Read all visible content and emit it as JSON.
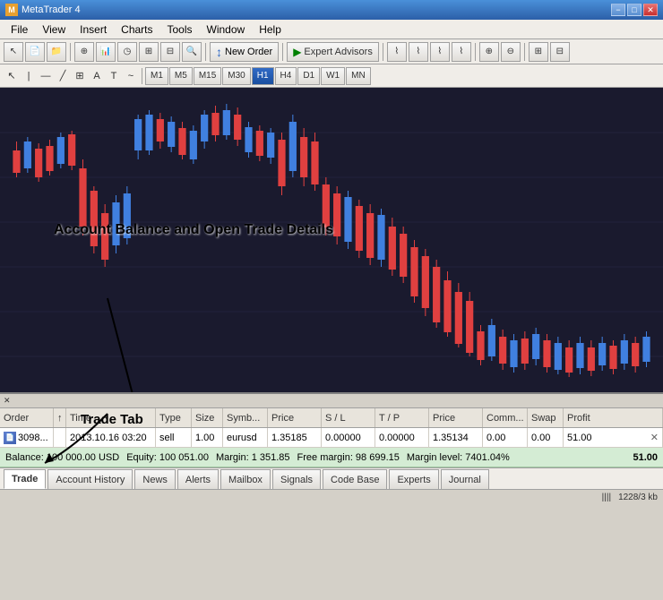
{
  "titleBar": {
    "title": "MetaTrader 4",
    "minimizeLabel": "−",
    "maximizeLabel": "□",
    "closeLabel": "✕"
  },
  "menuBar": {
    "items": [
      "File",
      "View",
      "Insert",
      "Charts",
      "Tools",
      "Window",
      "Help"
    ]
  },
  "toolbar": {
    "newOrderLabel": "New Order",
    "expertAdvisorsLabel": "Expert Advisors"
  },
  "timeframes": {
    "tools": [
      "↖",
      "|",
      "—",
      "╱",
      "⊕",
      "A",
      "T",
      "~"
    ],
    "periods": [
      "M1",
      "M5",
      "M15",
      "M30",
      "H1",
      "H4",
      "D1",
      "W1",
      "MN"
    ],
    "active": "H1"
  },
  "annotation": {
    "text": "Account Balance and Open Trade Details",
    "tradeTabText": "Trade Tab"
  },
  "table": {
    "headers": [
      "Order",
      "/",
      "Time",
      "Type",
      "Size",
      "Symb...",
      "Price",
      "S / L",
      "T / P",
      "Price",
      "Comm...",
      "Swap",
      "Profit"
    ],
    "widths": [
      60,
      14,
      100,
      40,
      35,
      50,
      60,
      60,
      60,
      60,
      50,
      40,
      55
    ],
    "rows": [
      {
        "order": "3098...",
        "time": "2013.10.16 03:20",
        "type": "sell",
        "size": "1.00",
        "symbol": "eurusd",
        "price": "1.35185",
        "sl": "0.00000",
        "tp": "0.00000",
        "currentPrice": "1.35134",
        "comm": "0.00",
        "swap": "0.00",
        "profit": "51.00"
      }
    ]
  },
  "balanceBar": {
    "balance": "Balance: 100 000.00 USD",
    "equity": "Equity: 100 051.00",
    "margin": "Margin: 1 351.85",
    "freeMargin": "Free margin: 98 699.15",
    "marginLevel": "Margin level: 7401.04%",
    "profitValue": "51.00"
  },
  "tabs": {
    "items": [
      "Trade",
      "Account History",
      "News",
      "Alerts",
      "Mailbox",
      "Signals",
      "Code Base",
      "Experts",
      "Journal"
    ],
    "active": "Trade"
  },
  "statusBar": {
    "info": "1228/3 kb"
  }
}
